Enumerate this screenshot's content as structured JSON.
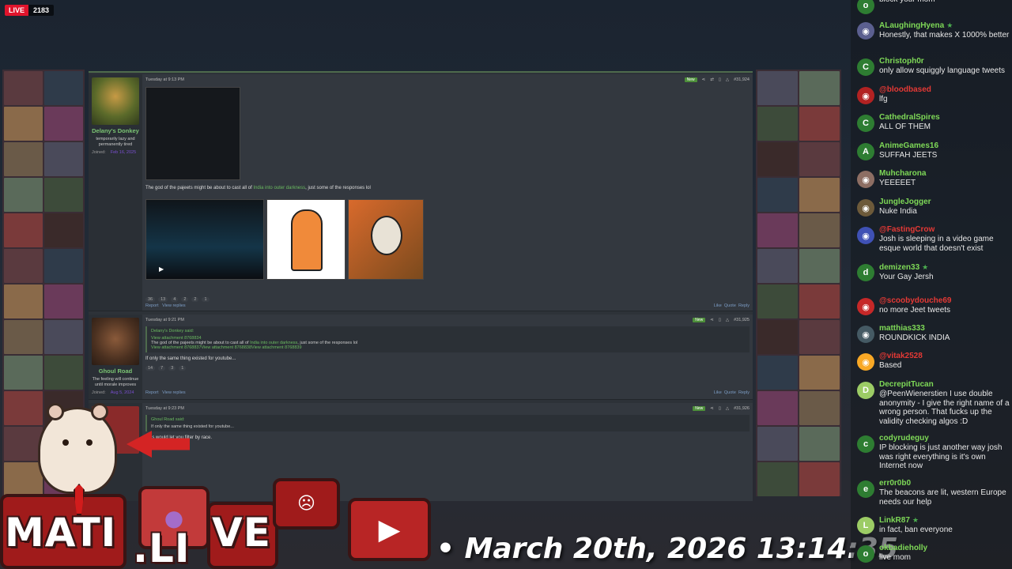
{
  "stream": {
    "live_label": "LIVE",
    "viewer_count": "2183",
    "timestamp": "• March 20th, 2026 13:14:35"
  },
  "logo": {
    "part1": "MATI",
    "part2": ".LI",
    "part3": "VE"
  },
  "forum": {
    "posts": [
      {
        "time": "Tuesday at 9:13 PM",
        "number": "#31,924",
        "new_label": "New",
        "username": "Delany's Donkey",
        "user_title": "temporarily lazy and permanently tired",
        "joined_label": "Joined:",
        "joined_date": "Feb 16, 2025",
        "text_before": "The god of the pajeets might be about to cast all of ",
        "text_link": "India into outer darkness",
        "text_after": ", just some of the responses lol",
        "reactions": [
          "36",
          "13",
          "4",
          "2",
          "2",
          "1"
        ],
        "report": "Report",
        "view_replies": "View replies",
        "like": "Like",
        "quote": "Quote",
        "reply": "Reply"
      },
      {
        "time": "Tuesday at 9:21 PM",
        "number": "#31,925",
        "new_label": "New",
        "username": "Ghoul Road",
        "user_title": "The feeling will continue until morale improves",
        "joined_label": "Joined:",
        "joined_date": "Aug 5, 2024",
        "quote_author": "Delany's Donkey said:",
        "quote_attach": "View attachment 8768834",
        "quote_text_before": "The god of the pajeets might be about to cast all of ",
        "quote_text_link": "India into outer darkness",
        "quote_text_after": ", just some of the responses lol",
        "quote_attach2": "View attachment 8768837View attachment 8768838View attachment 8768839",
        "text": "If only the same thing existed for youtube...",
        "reactions": [
          "14",
          "7",
          "3",
          "1"
        ],
        "report": "Report",
        "view_replies": "View replies",
        "like": "Like",
        "quote": "Quote",
        "reply": "Reply"
      },
      {
        "time": "Tuesday at 9:23 PM",
        "number": "#31,926",
        "new_label": "New",
        "quote_author": "Ghoul Road said:",
        "quote_text": "If only the same thing existed for youtube...",
        "text": "...es would let you filter by race."
      }
    ]
  },
  "chat": [
    {
      "user": "",
      "text": "block your mom",
      "color": "#7ed957",
      "avatar": "o",
      "avatar_bg": "#2e7d32",
      "star": false
    },
    {
      "user": "ALaughingHyena",
      "text": "Honestly, that makes X 1000% better",
      "color": "#7ed957",
      "avatar": "◉",
      "avatar_bg": "#5b5f8f",
      "star": true
    },
    {
      "user": "Christoph0r",
      "text": "only allow squiggly language tweets",
      "color": "#7ed957",
      "avatar": "C",
      "avatar_bg": "#2e7d32",
      "star": false
    },
    {
      "user": "@bloodbased",
      "text": "lfg",
      "color": "#e53935",
      "avatar": "◉",
      "avatar_bg": "#b22222",
      "star": false
    },
    {
      "user": "CathedralSpires",
      "text": "ALL OF THEM",
      "color": "#7ed957",
      "avatar": "C",
      "avatar_bg": "#2e7d32",
      "star": false
    },
    {
      "user": "AnimeGames16",
      "text": "SUFFAH JEETS",
      "color": "#7ed957",
      "avatar": "A",
      "avatar_bg": "#2e7d32",
      "star": false
    },
    {
      "user": "Muhcharona",
      "text": "YEEEEET",
      "color": "#7ed957",
      "avatar": "◉",
      "avatar_bg": "#8d6e63",
      "star": false
    },
    {
      "user": "JungleJogger",
      "text": "Nuke India",
      "color": "#7ed957",
      "avatar": "◉",
      "avatar_bg": "#6d5a3a",
      "star": false
    },
    {
      "user": "@FastingCrow",
      "text": "Josh is sleeping in a video game esque world that doesn't exist",
      "color": "#e53935",
      "avatar": "◉",
      "avatar_bg": "#3f51b5",
      "star": false
    },
    {
      "user": "demizen33",
      "text": "Your Gay Jersh",
      "color": "#7ed957",
      "avatar": "d",
      "avatar_bg": "#2e7d32",
      "star": true
    },
    {
      "user": "@scoobydouche69",
      "text": "no more Jeet tweets",
      "color": "#e53935",
      "avatar": "◉",
      "avatar_bg": "#c62828",
      "star": false
    },
    {
      "user": "matthias333",
      "text": "ROUNDKICK INDIA",
      "color": "#7ed957",
      "avatar": "◉",
      "avatar_bg": "#455a64",
      "star": false
    },
    {
      "user": "@vitak2528",
      "text": "Based",
      "color": "#e53935",
      "avatar": "◉",
      "avatar_bg": "#f9a825",
      "star": false
    },
    {
      "user": "DecrepitTucan",
      "text": "@PeenWienerstien I use double anonymity - I give the right name of a wrong person. That fucks up the validity checking algos :D",
      "color": "#7ed957",
      "avatar": "D",
      "avatar_bg": "#9ccc65",
      "star": false
    },
    {
      "user": "codyrudeguy",
      "text": "IP blocking is just another way josh was right everything is it's own Internet now",
      "color": "#7ed957",
      "avatar": "c",
      "avatar_bg": "#2e7d32",
      "star": false
    },
    {
      "user": "err0r0b0",
      "text": "The beacons are lit, western Europe needs our help",
      "color": "#7ed957",
      "avatar": "e",
      "avatar_bg": "#2e7d32",
      "star": false
    },
    {
      "user": "LinkR87",
      "text": "in fact, ban everyone",
      "color": "#7ed957",
      "avatar": "L",
      "avatar_bg": "#9ccc65",
      "star": true
    },
    {
      "user": "okbadieholly",
      "text": "live mom",
      "color": "#7ed957",
      "avatar": "o",
      "avatar_bg": "#2e7d32",
      "star": false
    }
  ]
}
